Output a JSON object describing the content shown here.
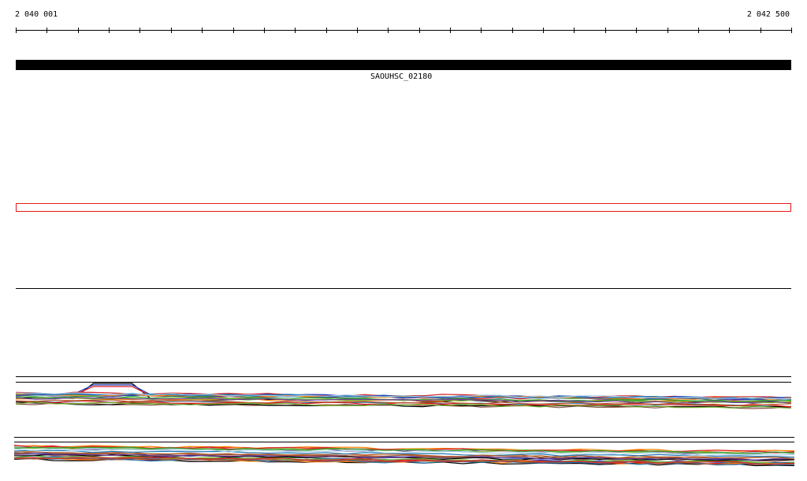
{
  "ruler": {
    "start_label": "2 040 001",
    "end_label": "2 042 500",
    "tick_count": 26
  },
  "gene": {
    "name": "SAOUHSC_02180",
    "color": "#000000"
  },
  "selection": {
    "border_color": "#e31a1c"
  },
  "expression_tracks": {
    "palette": [
      "#000000",
      "#1f3fbf",
      "#e31a1c",
      "#33a02c",
      "#ff7f00",
      "#6a3d9a",
      "#b15928",
      "#1f78b4",
      "#a6cee3",
      "#7fbf3f",
      "#8c564b",
      "#d62728"
    ]
  }
}
